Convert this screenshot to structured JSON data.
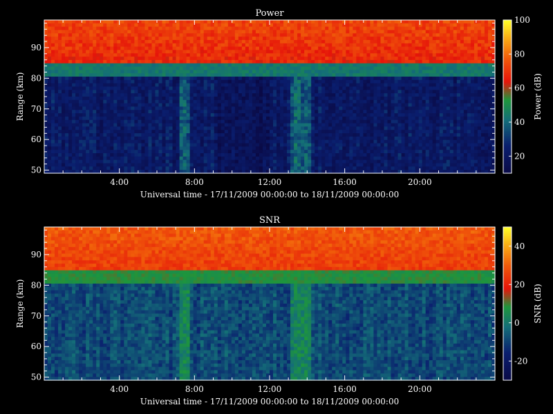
{
  "chart_data": [
    {
      "type": "heatmap",
      "title": "Power",
      "xlabel": "Universal time - 17/11/2009 00:00:00 to 18/11/2009 00:00:00",
      "ylabel": "Range (km)",
      "x_range_hours": [
        0,
        24
      ],
      "ylim": [
        49,
        99
      ],
      "x_ticks": [
        "4:00",
        "8:00",
        "12:00",
        "16:00",
        "20:00"
      ],
      "x_tick_hours": [
        4,
        8,
        12,
        16,
        20
      ],
      "y_ticks": [
        50,
        60,
        70,
        80,
        90
      ],
      "colorbar": {
        "label": "Power (dB)",
        "range": [
          10,
          100
        ],
        "ticks": [
          20,
          40,
          60,
          80,
          100
        ]
      },
      "features": {
        "background_low_level": 22,
        "layer_boundary_km": 82,
        "upper_level": 66,
        "enhanced_columns_hours": [
          [
            7.2,
            7.8
          ],
          [
            13.2,
            14.3
          ]
        ],
        "low_region_hours": [
          [
            9.0,
            12.0
          ]
        ]
      }
    },
    {
      "type": "heatmap",
      "title": "SNR",
      "xlabel": "Universal time - 17/11/2009 00:00:00 to 18/11/2009 00:00:00",
      "ylabel": "Range (km)",
      "x_range_hours": [
        0,
        24
      ],
      "ylim": [
        49,
        99
      ],
      "x_ticks": [
        "4:00",
        "8:00",
        "12:00",
        "16:00",
        "20:00"
      ],
      "x_tick_hours": [
        4,
        8,
        12,
        16,
        20
      ],
      "y_ticks": [
        50,
        60,
        70,
        80,
        90
      ],
      "colorbar": {
        "label": "SNR (dB)",
        "range": [
          -30,
          50
        ],
        "ticks": [
          -20,
          0,
          20,
          40
        ]
      },
      "features": {
        "background_low_level": -8,
        "layer_boundary_km": 82,
        "upper_level": 24,
        "enhanced_columns_hours": [
          [
            7.2,
            7.8
          ],
          [
            13.2,
            14.3
          ]
        ]
      }
    }
  ]
}
